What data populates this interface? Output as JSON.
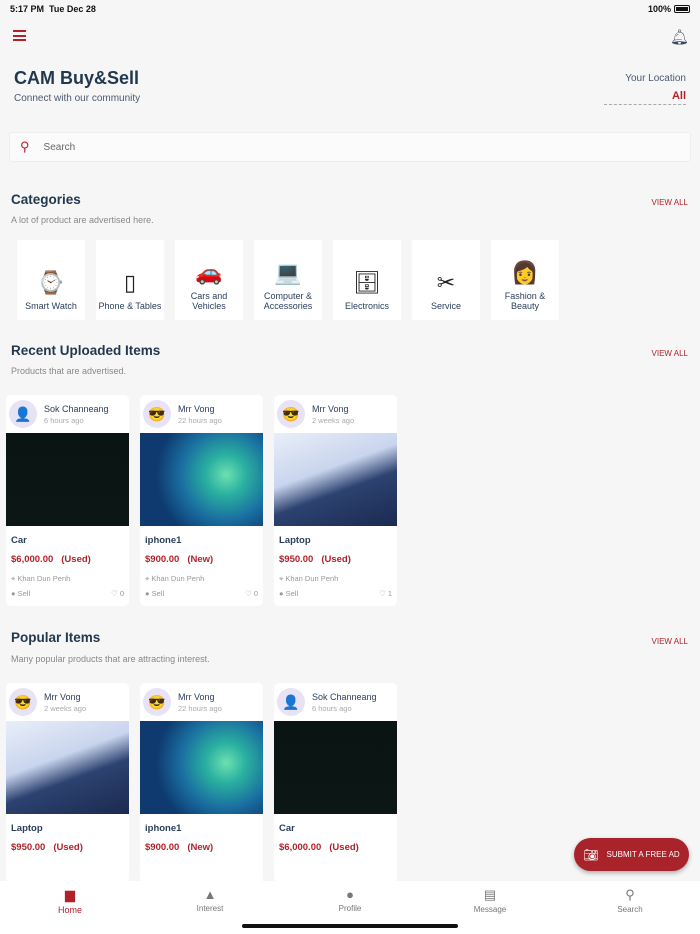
{
  "status": {
    "time": "5:17 PM",
    "date": "Tue Dec 28",
    "battery": "100%"
  },
  "header": {
    "title": "CAM Buy&Sell",
    "subtitle": "Connect with our community",
    "location_label": "Your Location",
    "location_value": "All"
  },
  "search": {
    "placeholder": "Search"
  },
  "categories": {
    "title": "Categories",
    "subtitle": "A lot of product are advertised here.",
    "view_all": "VIEW ALL",
    "items": [
      {
        "label": "Smart Watch",
        "icon": "⌚"
      },
      {
        "label": "Phone & Tables",
        "icon": "▯"
      },
      {
        "label": "Cars and Vehicles",
        "icon": "🚗"
      },
      {
        "label": "Computer & Accessories",
        "icon": "💻"
      },
      {
        "label": "Electronics",
        "icon": "🗄"
      },
      {
        "label": "Service",
        "icon": "✂"
      },
      {
        "label": "Fashion & Beauty",
        "icon": "👩"
      }
    ]
  },
  "recent": {
    "title": "Recent Uploaded Items",
    "subtitle": "Products that are advertised.",
    "view_all": "VIEW ALL",
    "items": [
      {
        "user": "Sok Channeang",
        "time": "6 hours ago",
        "name": "Car",
        "price": "$6,000.00",
        "condition": "(Used)",
        "location": "Khan Dun Penh",
        "type": "Sell",
        "likes": "0",
        "image": "car"
      },
      {
        "user": "Mrr Vong",
        "time": "22 hours ago",
        "name": "iphone1",
        "price": "$900.00",
        "condition": "(New)",
        "location": "Khan Dun Penh",
        "type": "Sell",
        "likes": "0",
        "image": "phone"
      },
      {
        "user": "Mrr Vong",
        "time": "2 weeks ago",
        "name": "Laptop",
        "price": "$950.00",
        "condition": "(Used)",
        "location": "Khan Dun Penh",
        "type": "Sell",
        "likes": "1",
        "image": "laptop"
      }
    ]
  },
  "popular": {
    "title": "Popular Items",
    "subtitle": "Many popular products that are attracting interest.",
    "view_all": "VIEW ALL",
    "items": [
      {
        "user": "Mrr Vong",
        "time": "2 weeks ago",
        "name": "Laptop",
        "price": "$950.00",
        "condition": "(Used)",
        "image": "laptop"
      },
      {
        "user": "Mrr Vong",
        "time": "22 hours ago",
        "name": "iphone1",
        "price": "$900.00",
        "condition": "(New)",
        "image": "phone"
      },
      {
        "user": "Sok Channeang",
        "time": "6 hours ago",
        "name": "Car",
        "price": "$6,000.00",
        "condition": "(Used)",
        "image": "car"
      }
    ]
  },
  "fab": {
    "label": "SUBMIT A FREE AD"
  },
  "nav": {
    "active": "Home",
    "items": [
      {
        "label": "Home",
        "icon": "▆"
      },
      {
        "label": "Interest",
        "icon": "▲"
      },
      {
        "label": "Profile",
        "icon": "●"
      },
      {
        "label": "Message",
        "icon": "▤"
      },
      {
        "label": "Search",
        "icon": "⚲"
      }
    ]
  },
  "colors": {
    "accent": "#b0222a",
    "title": "#22384f"
  }
}
